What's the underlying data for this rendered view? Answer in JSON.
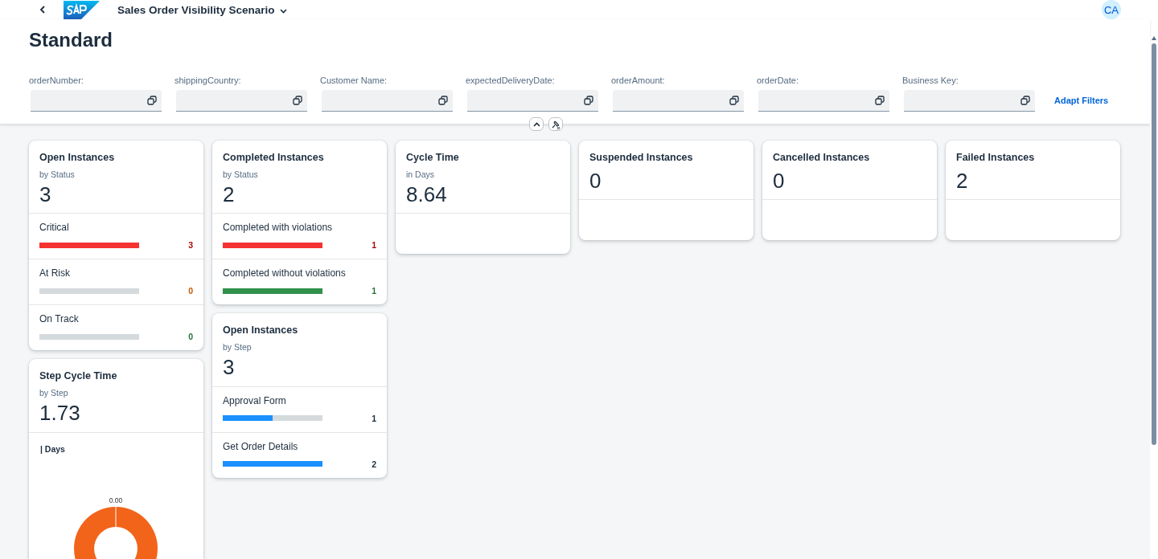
{
  "shell": {
    "title": "Sales Order Visibility Scenario",
    "avatar": "CA"
  },
  "page": {
    "title": "Standard"
  },
  "filters": [
    {
      "label": "orderNumber:"
    },
    {
      "label": "shippingCountry:"
    },
    {
      "label": "Customer Name:"
    },
    {
      "label": "expectedDeliveryDate:"
    },
    {
      "label": "orderAmount:"
    },
    {
      "label": "orderDate:"
    },
    {
      "label": "Business Key:"
    }
  ],
  "adapt_filters": "Adapt Filters",
  "columns": [
    [
      {
        "title": "Open Instances",
        "subtitle": "by Status",
        "value": "3",
        "rows": [
          {
            "label": "Critical",
            "level": 1,
            "value": "3",
            "kind": "negative"
          },
          {
            "label": "At Risk",
            "level": 0,
            "value": "0",
            "kind": "warning"
          },
          {
            "label": "On Track",
            "level": 0,
            "value": "0",
            "kind": "positive"
          }
        ]
      },
      {
        "title": "Step Cycle Time",
        "subtitle": "by Step",
        "value": "1.73",
        "donut": {
          "title": "| Days",
          "label": "0.00"
        }
      }
    ],
    [
      {
        "title": "Completed Instances",
        "subtitle": "by Status",
        "value": "2",
        "rows": [
          {
            "label": "Completed with violations",
            "level": 1,
            "value": "1",
            "kind": "negative"
          },
          {
            "label": "Completed without violations",
            "level": 1,
            "value": "1",
            "kind": "positive"
          }
        ]
      },
      {
        "title": "Open Instances",
        "subtitle": "by Step",
        "value": "3",
        "rows": [
          {
            "label": "Approval Form",
            "level": 0.5,
            "value": "1",
            "kind": "neutral"
          },
          {
            "label": "Get Order Details",
            "level": 1,
            "value": "2",
            "kind": "neutral"
          }
        ]
      }
    ],
    [
      {
        "title": "Cycle Time",
        "subtitle": "in Days",
        "value": "8.64"
      }
    ],
    [
      {
        "title": "Suspended Instances",
        "value": "0"
      }
    ],
    [
      {
        "title": "Cancelled Instances",
        "value": "0"
      }
    ],
    [
      {
        "title": "Failed Instances",
        "value": "2"
      }
    ]
  ]
}
